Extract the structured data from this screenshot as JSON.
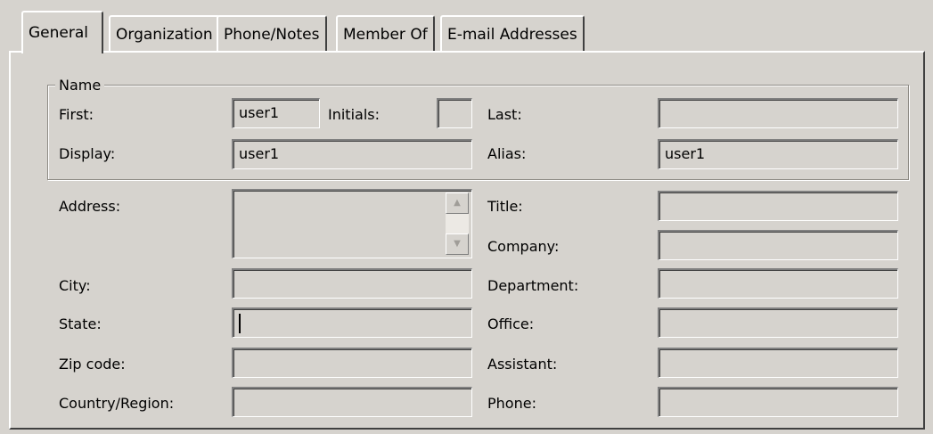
{
  "tabs": [
    {
      "label": "General",
      "active": true
    },
    {
      "label": "Organization"
    },
    {
      "label": "Phone/Notes"
    },
    {
      "label": "Member Of"
    },
    {
      "label": "E-mail Addresses"
    }
  ],
  "name_group": {
    "legend": "Name",
    "first_label": "First:",
    "first_value": "user1",
    "initials_label": "Initials:",
    "initials_value": "",
    "last_label": "Last:",
    "last_value": "",
    "display_label": "Display:",
    "display_value": "user1",
    "alias_label": "Alias:",
    "alias_value": "user1"
  },
  "fields": {
    "address_label": "Address:",
    "address_value": "",
    "city_label": "City:",
    "city_value": "",
    "state_label": "State:",
    "state_value": "",
    "zip_label": "Zip code:",
    "zip_value": "",
    "country_label": "Country/Region:",
    "country_value": "",
    "title_label": "Title:",
    "title_value": "",
    "company_label": "Company:",
    "company_value": "",
    "department_label": "Department:",
    "department_value": "",
    "office_label": "Office:",
    "office_value": "",
    "assistant_label": "Assistant:",
    "assistant_value": "",
    "phone_label": "Phone:",
    "phone_value": ""
  },
  "icons": {
    "scroll_up": "scroll-up-arrow-icon",
    "scroll_down": "scroll-down-arrow-icon"
  }
}
